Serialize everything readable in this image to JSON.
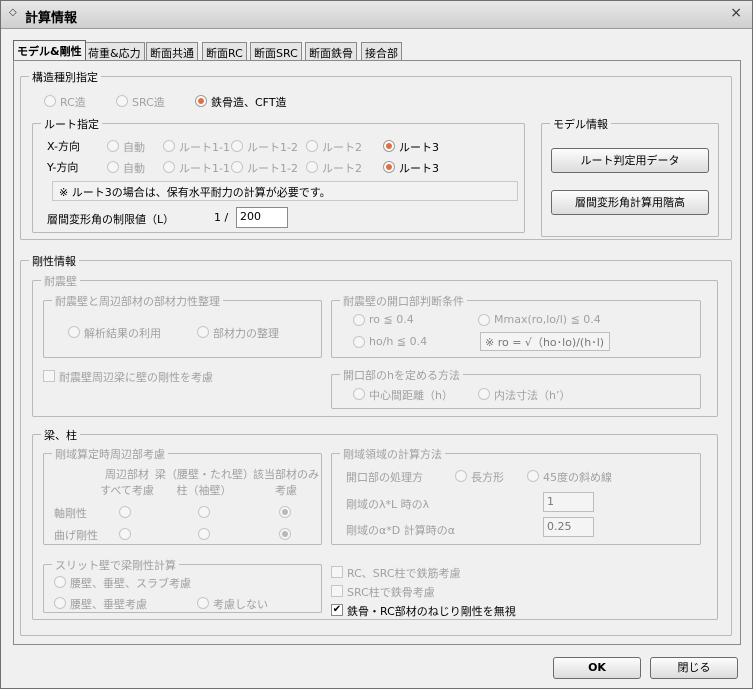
{
  "window": {
    "title": "計算情報",
    "close_label": "×"
  },
  "tabs": [
    {
      "label": "モデル&剛性",
      "active": true
    },
    {
      "label": "荷重&応力"
    },
    {
      "label": "断面共通"
    },
    {
      "label": "断面RC"
    },
    {
      "label": "断面SRC"
    },
    {
      "label": "断面鉄骨"
    },
    {
      "label": "接合部"
    }
  ],
  "structure": {
    "label": "構造種別指定",
    "options": [
      {
        "label": "RC造",
        "selected": false,
        "enabled": false
      },
      {
        "label": "SRC造",
        "selected": false,
        "enabled": false
      },
      {
        "label": "鉄骨造、CFT造",
        "selected": true,
        "enabled": true
      }
    ]
  },
  "route": {
    "label": "ルート指定",
    "x_dir": "X-方向",
    "y_dir": "Y-方向",
    "options": [
      "自動",
      "ルート1-1",
      "ルート1-2",
      "ルート2",
      "ルート3"
    ],
    "x_selected": "ルート3",
    "y_selected": "ルート3",
    "note": "※ ルート3の場合は、保有水平耐力の計算が必要です。",
    "drift_label": "層間変形角の制限値（L）",
    "drift_prefix": "1 /",
    "drift_value": "200"
  },
  "model_info": {
    "label": "モデル情報",
    "route_data_button": "ルート判定用データ",
    "story_height_button": "層間変形角計算用階高"
  },
  "stiffness": {
    "label": "剛性情報",
    "shear_wall": {
      "label": "耐震壁",
      "organize": {
        "label": "耐震壁と周辺部材の部材力性整理",
        "options": [
          "解析結果の利用",
          "部材力の整理"
        ]
      },
      "opening": {
        "label": "耐震壁の開口部判断条件",
        "opt1": "ro ≦ 0.4",
        "opt2": "Mmax(ro,lo/l) ≦ 0.4",
        "opt3": "ho/h ≦ 0.4",
        "formula": "※ ro = √（ho･lo)/(h･l)"
      },
      "consider_beam": "耐震壁周辺梁に壁の剛性を考慮",
      "h_method": {
        "label": "開口部のhを定める方法",
        "options": [
          "中心間距離（h）",
          "内法寸法（h’）"
        ]
      }
    },
    "beam_column": {
      "label": "梁、柱",
      "perimeter": {
        "label": "剛域算定時周辺部考慮",
        "col1": [
          "周辺部材",
          "すべて考慮"
        ],
        "col2": [
          "梁（腰壁・たれ壁）",
          "柱（袖壁）"
        ],
        "col3": [
          "該当部材のみ",
          "考慮"
        ],
        "rows": [
          {
            "label": "軸剛性",
            "selected": 3
          },
          {
            "label": "曲げ剛性",
            "selected": 3
          }
        ]
      },
      "rigid_zone": {
        "label": "剛域領域の計算方法",
        "opening_label": "開口部の処理方",
        "opening_options": [
          "長方形",
          "45度の斜め線"
        ],
        "lambda_label": "剛域のλ*L 時のλ",
        "lambda_value": "1",
        "alpha_label": "剛域のα*D 計算時のα",
        "alpha_value": "0.25"
      },
      "slit": {
        "label": "スリット壁で梁剛性計算",
        "options": [
          "腰壁、垂壁、スラブ考慮",
          "腰壁、垂壁考慮",
          "考慮しない"
        ]
      },
      "checks": [
        {
          "label": "RC、SRC柱で鉄筋考慮",
          "checked": false,
          "enabled": false
        },
        {
          "label": "SRC柱で鉄骨考慮",
          "checked": false,
          "enabled": false
        },
        {
          "label": "鉄骨・RC部材のねじり剛性を無視",
          "checked": true,
          "enabled": true
        }
      ]
    }
  },
  "footer": {
    "ok": "OK",
    "close": "閉じる"
  },
  "colors": {
    "radio_selected": "#e0703e",
    "disabled_text": "#a0a0a0"
  }
}
